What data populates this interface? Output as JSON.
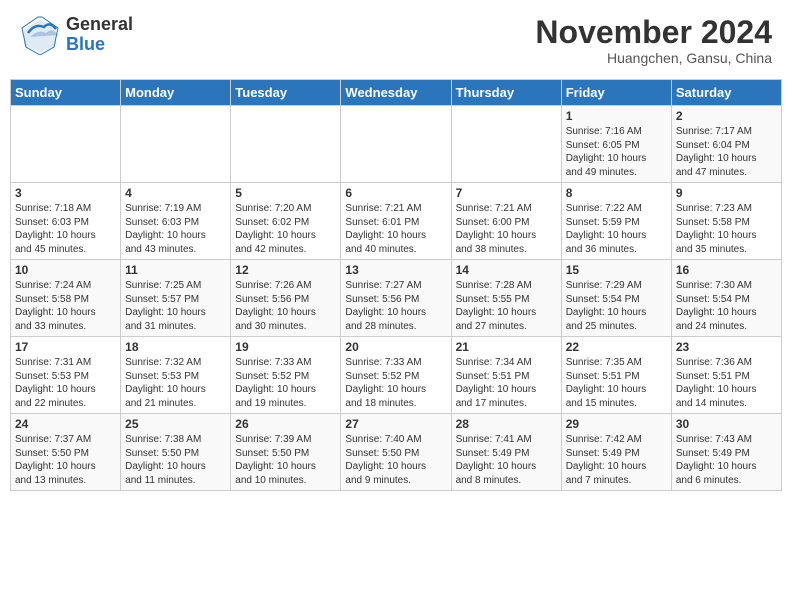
{
  "header": {
    "logo_general": "General",
    "logo_blue": "Blue",
    "month_title": "November 2024",
    "location": "Huangchen, Gansu, China"
  },
  "calendar": {
    "columns": [
      "Sunday",
      "Monday",
      "Tuesday",
      "Wednesday",
      "Thursday",
      "Friday",
      "Saturday"
    ],
    "rows": [
      [
        {
          "day": "",
          "info": ""
        },
        {
          "day": "",
          "info": ""
        },
        {
          "day": "",
          "info": ""
        },
        {
          "day": "",
          "info": ""
        },
        {
          "day": "",
          "info": ""
        },
        {
          "day": "1",
          "info": "Sunrise: 7:16 AM\nSunset: 6:05 PM\nDaylight: 10 hours\nand 49 minutes."
        },
        {
          "day": "2",
          "info": "Sunrise: 7:17 AM\nSunset: 6:04 PM\nDaylight: 10 hours\nand 47 minutes."
        }
      ],
      [
        {
          "day": "3",
          "info": "Sunrise: 7:18 AM\nSunset: 6:03 PM\nDaylight: 10 hours\nand 45 minutes."
        },
        {
          "day": "4",
          "info": "Sunrise: 7:19 AM\nSunset: 6:03 PM\nDaylight: 10 hours\nand 43 minutes."
        },
        {
          "day": "5",
          "info": "Sunrise: 7:20 AM\nSunset: 6:02 PM\nDaylight: 10 hours\nand 42 minutes."
        },
        {
          "day": "6",
          "info": "Sunrise: 7:21 AM\nSunset: 6:01 PM\nDaylight: 10 hours\nand 40 minutes."
        },
        {
          "day": "7",
          "info": "Sunrise: 7:21 AM\nSunset: 6:00 PM\nDaylight: 10 hours\nand 38 minutes."
        },
        {
          "day": "8",
          "info": "Sunrise: 7:22 AM\nSunset: 5:59 PM\nDaylight: 10 hours\nand 36 minutes."
        },
        {
          "day": "9",
          "info": "Sunrise: 7:23 AM\nSunset: 5:58 PM\nDaylight: 10 hours\nand 35 minutes."
        }
      ],
      [
        {
          "day": "10",
          "info": "Sunrise: 7:24 AM\nSunset: 5:58 PM\nDaylight: 10 hours\nand 33 minutes."
        },
        {
          "day": "11",
          "info": "Sunrise: 7:25 AM\nSunset: 5:57 PM\nDaylight: 10 hours\nand 31 minutes."
        },
        {
          "day": "12",
          "info": "Sunrise: 7:26 AM\nSunset: 5:56 PM\nDaylight: 10 hours\nand 30 minutes."
        },
        {
          "day": "13",
          "info": "Sunrise: 7:27 AM\nSunset: 5:56 PM\nDaylight: 10 hours\nand 28 minutes."
        },
        {
          "day": "14",
          "info": "Sunrise: 7:28 AM\nSunset: 5:55 PM\nDaylight: 10 hours\nand 27 minutes."
        },
        {
          "day": "15",
          "info": "Sunrise: 7:29 AM\nSunset: 5:54 PM\nDaylight: 10 hours\nand 25 minutes."
        },
        {
          "day": "16",
          "info": "Sunrise: 7:30 AM\nSunset: 5:54 PM\nDaylight: 10 hours\nand 24 minutes."
        }
      ],
      [
        {
          "day": "17",
          "info": "Sunrise: 7:31 AM\nSunset: 5:53 PM\nDaylight: 10 hours\nand 22 minutes."
        },
        {
          "day": "18",
          "info": "Sunrise: 7:32 AM\nSunset: 5:53 PM\nDaylight: 10 hours\nand 21 minutes."
        },
        {
          "day": "19",
          "info": "Sunrise: 7:33 AM\nSunset: 5:52 PM\nDaylight: 10 hours\nand 19 minutes."
        },
        {
          "day": "20",
          "info": "Sunrise: 7:33 AM\nSunset: 5:52 PM\nDaylight: 10 hours\nand 18 minutes."
        },
        {
          "day": "21",
          "info": "Sunrise: 7:34 AM\nSunset: 5:51 PM\nDaylight: 10 hours\nand 17 minutes."
        },
        {
          "day": "22",
          "info": "Sunrise: 7:35 AM\nSunset: 5:51 PM\nDaylight: 10 hours\nand 15 minutes."
        },
        {
          "day": "23",
          "info": "Sunrise: 7:36 AM\nSunset: 5:51 PM\nDaylight: 10 hours\nand 14 minutes."
        }
      ],
      [
        {
          "day": "24",
          "info": "Sunrise: 7:37 AM\nSunset: 5:50 PM\nDaylight: 10 hours\nand 13 minutes."
        },
        {
          "day": "25",
          "info": "Sunrise: 7:38 AM\nSunset: 5:50 PM\nDaylight: 10 hours\nand 11 minutes."
        },
        {
          "day": "26",
          "info": "Sunrise: 7:39 AM\nSunset: 5:50 PM\nDaylight: 10 hours\nand 10 minutes."
        },
        {
          "day": "27",
          "info": "Sunrise: 7:40 AM\nSunset: 5:50 PM\nDaylight: 10 hours\nand 9 minutes."
        },
        {
          "day": "28",
          "info": "Sunrise: 7:41 AM\nSunset: 5:49 PM\nDaylight: 10 hours\nand 8 minutes."
        },
        {
          "day": "29",
          "info": "Sunrise: 7:42 AM\nSunset: 5:49 PM\nDaylight: 10 hours\nand 7 minutes."
        },
        {
          "day": "30",
          "info": "Sunrise: 7:43 AM\nSunset: 5:49 PM\nDaylight: 10 hours\nand 6 minutes."
        }
      ]
    ]
  }
}
